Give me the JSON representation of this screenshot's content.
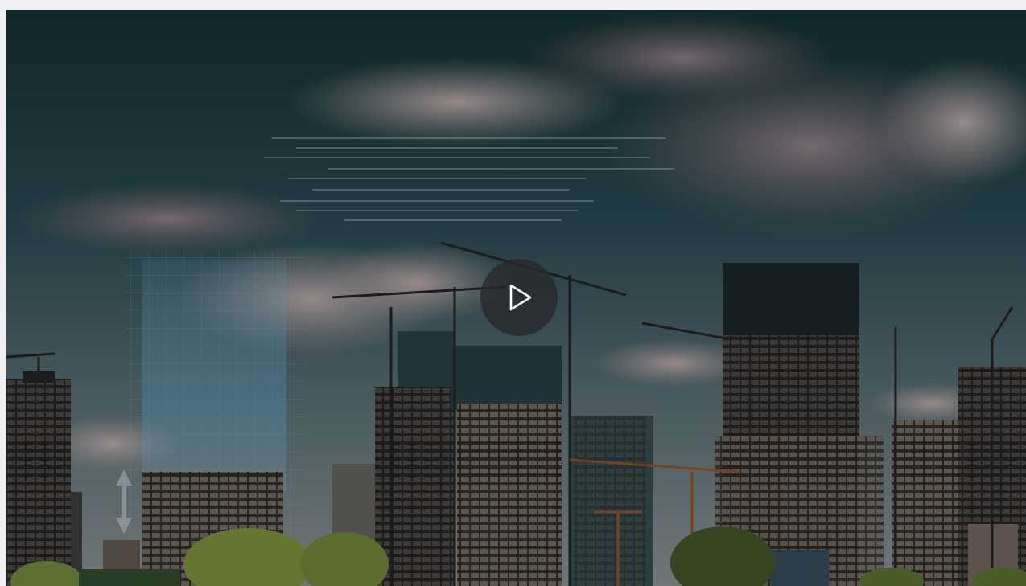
{
  "video": {
    "state": "paused",
    "overlay_tint": "#000000",
    "sky_top_color": "#1f4a4f",
    "sky_mid_color": "#3e6a78",
    "cloud_color": "#c9b4b4",
    "accent_hologram_color": "#8fd6ff"
  },
  "controls": {
    "play_icon": "play-icon",
    "play_button_color": "#2a2a2e",
    "play_icon_color": "#ffffff"
  }
}
